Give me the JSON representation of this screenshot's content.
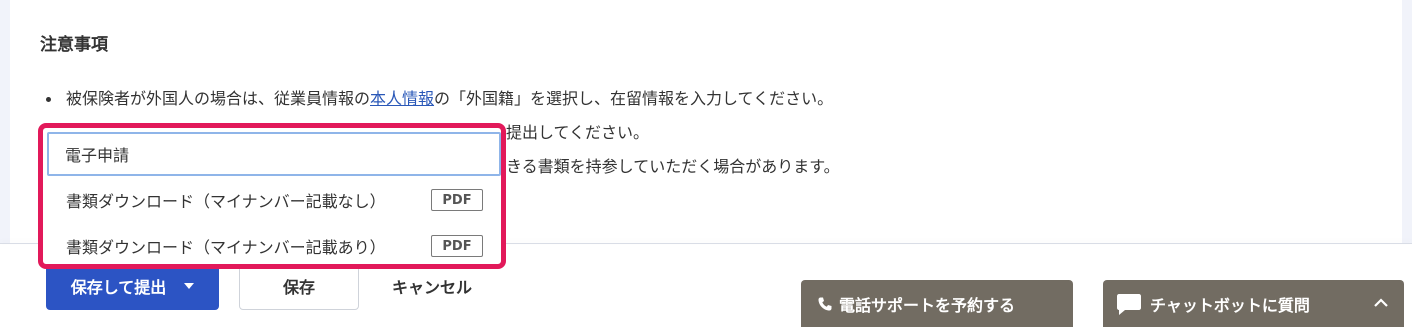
{
  "notice": {
    "title": "注意事項",
    "bullets": [
      {
        "before": "被保険者が外国人の場合は、従業員情報の",
        "link": "本人情報",
        "after": "の「外国籍」を選択し、在留情報を入力してください。"
      },
      {
        "text": "提出してください。"
      },
      {
        "text": "きる書類を持参していただく場合があります。"
      }
    ]
  },
  "dropdown": {
    "items": [
      {
        "label": "電子申請",
        "badge": ""
      },
      {
        "label": "書類ダウンロード（マイナンバー記載なし）",
        "badge": "PDF"
      },
      {
        "label": "書類ダウンロード（マイナンバー記載あり）",
        "badge": "PDF"
      }
    ],
    "highlight_color": "#e2195a"
  },
  "actions": {
    "submit_label": "保存して提出",
    "save_label": "保存",
    "cancel_label": "キャンセル"
  },
  "support": {
    "phone_label": "電話サポートを予約する",
    "chatbot_label": "チャットボットに質問"
  },
  "colors": {
    "primary": "#2c54c4",
    "support_bg": "#726c62",
    "link": "#2a58b8"
  }
}
